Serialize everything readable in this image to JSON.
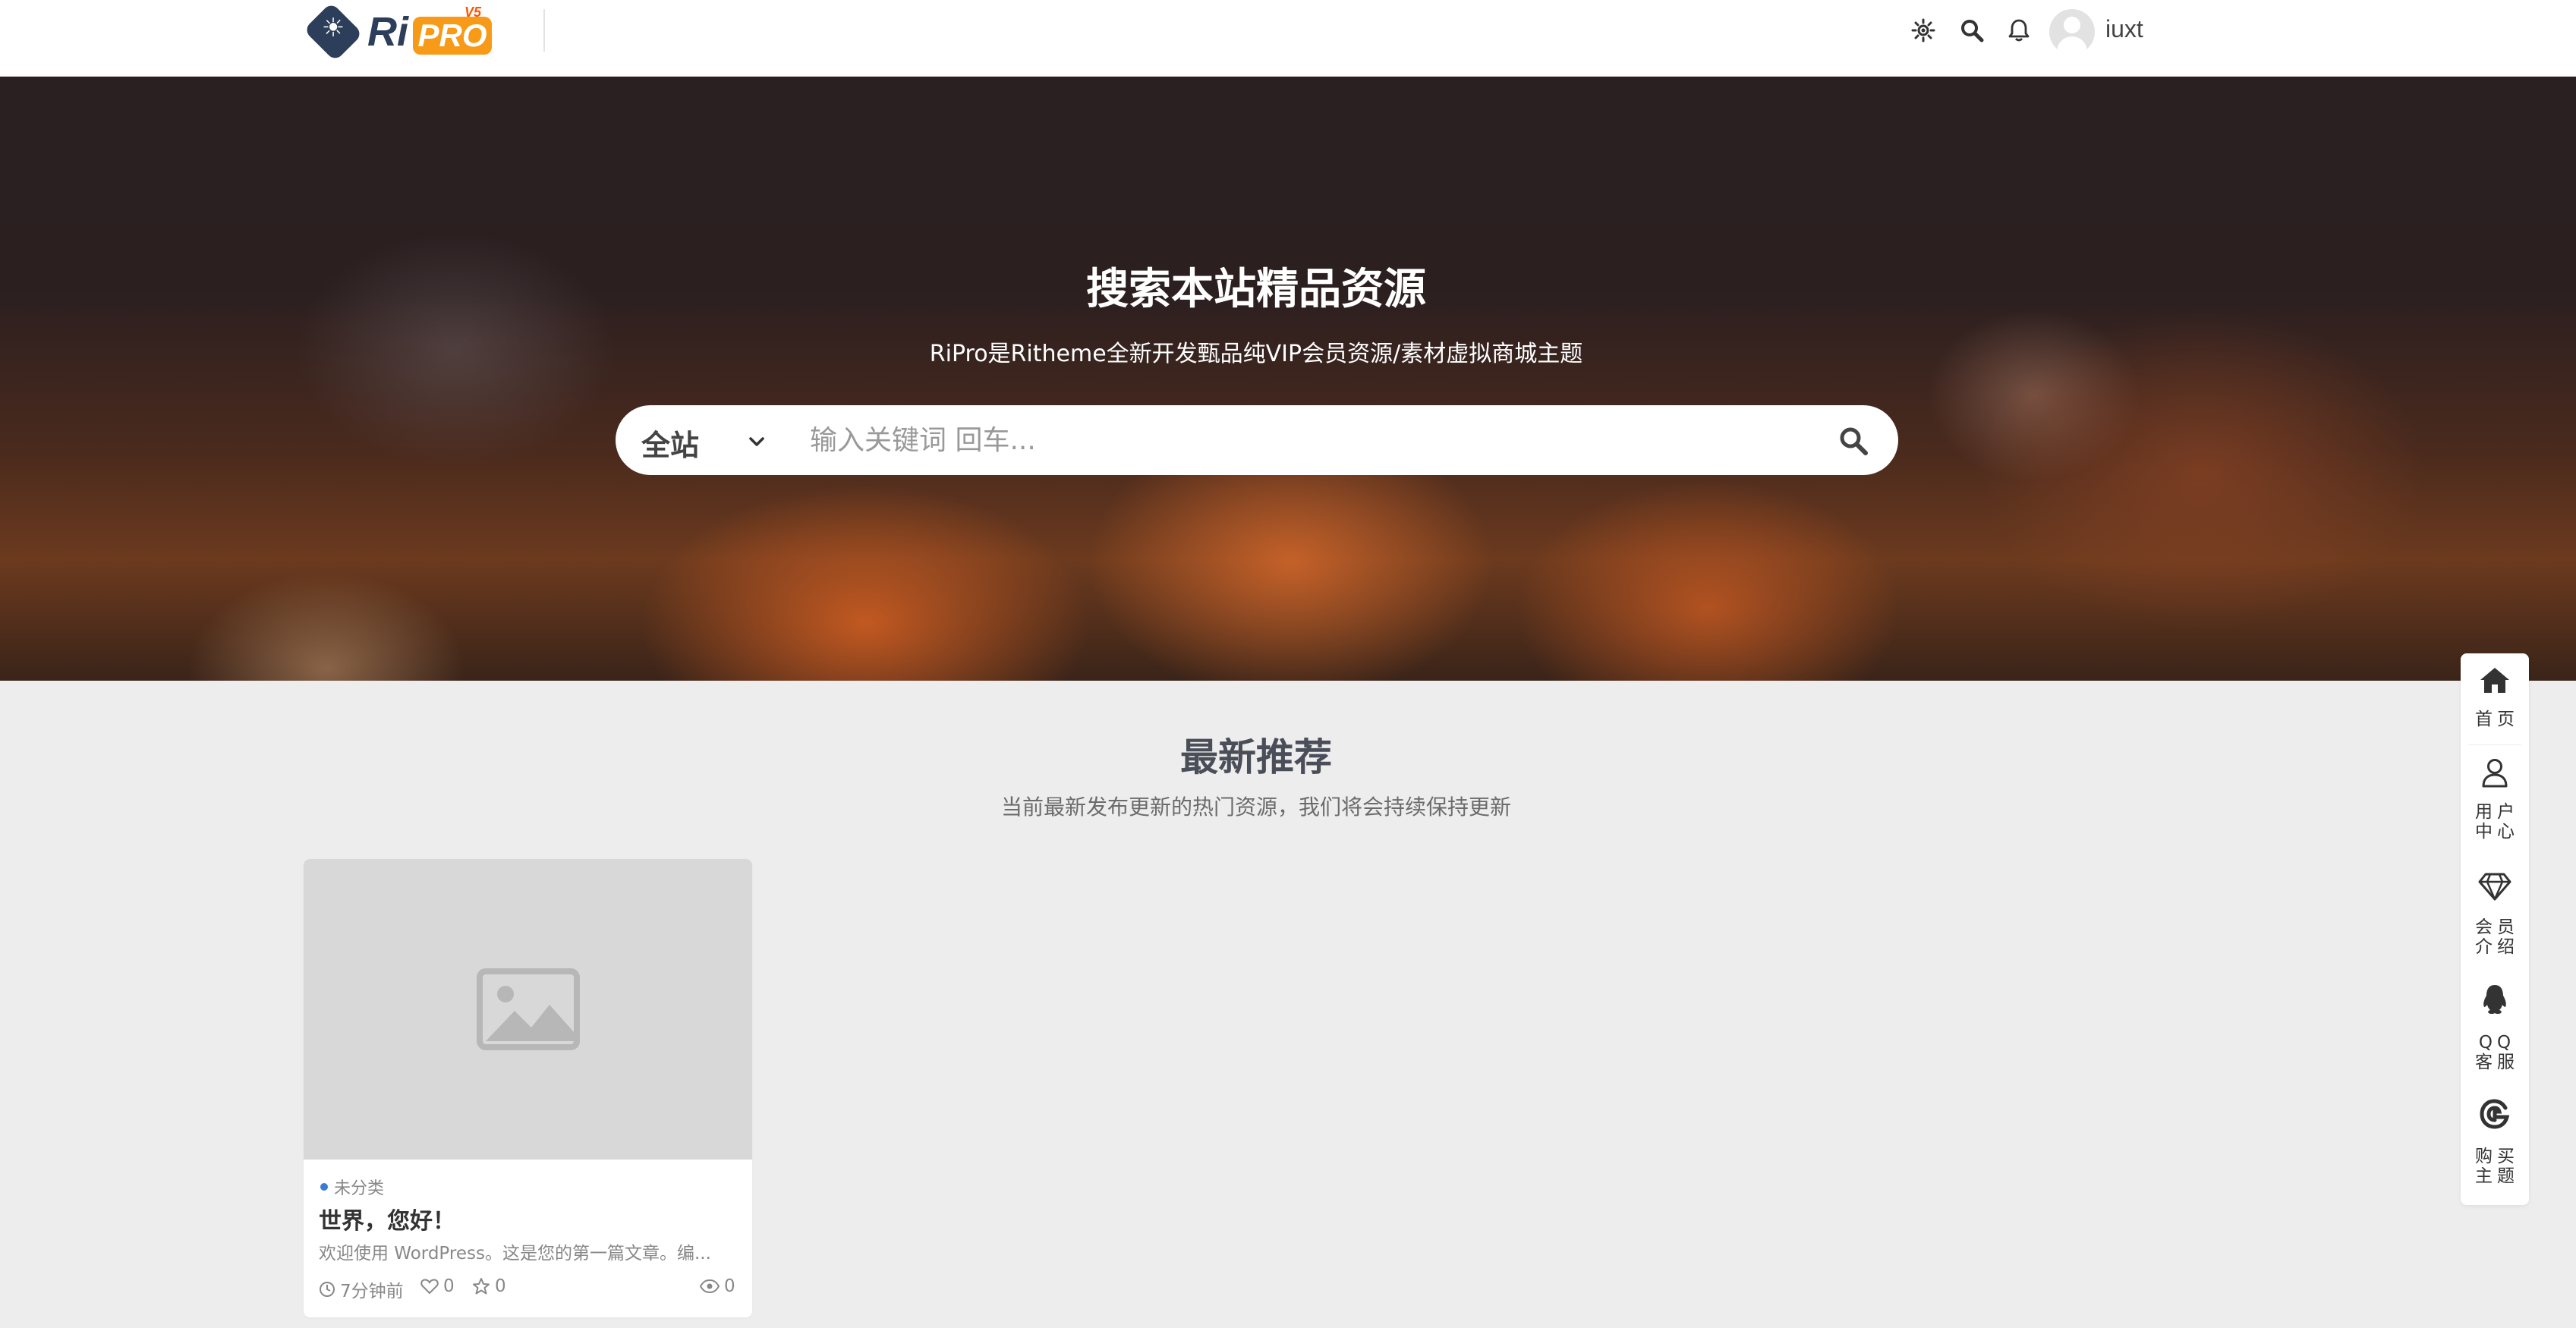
{
  "header": {
    "logo": {
      "ri": "Ri",
      "pro": "PRO",
      "version": "V5"
    },
    "username": "iuxt",
    "icons": [
      "theme-toggle-icon",
      "search-icon",
      "bell-icon",
      "avatar"
    ]
  },
  "hero": {
    "title": "搜索本站精品资源",
    "subtitle": "RiPro是Ritheme全新开发甄品纯VIP会员资源/素材虚拟商城主题",
    "search": {
      "category": "全站",
      "placeholder": "输入关键词 回车..."
    }
  },
  "section": {
    "title": "最新推荐",
    "subtitle": "当前最新发布更新的热门资源，我们将会持续保持更新"
  },
  "posts": [
    {
      "category": "未分类",
      "title": "世界，您好！",
      "excerpt": "欢迎使用 WordPress。这是您的第一篇文章。编...",
      "time": "7分钟前",
      "likes": "0",
      "favorites": "0",
      "views": "0"
    }
  ],
  "float_bar": {
    "items": [
      {
        "icon": "home-icon",
        "label": "首页"
      },
      {
        "icon": "user-icon",
        "label": "用户中心"
      },
      {
        "icon": "diamond-icon",
        "label": "会员介绍"
      },
      {
        "icon": "qq-icon",
        "label": "QQ客服"
      },
      {
        "icon": "buy-theme-icon",
        "label": "购买主题"
      }
    ],
    "labels_wrapped": [
      [
        "首页"
      ],
      [
        "用户",
        "中心"
      ],
      [
        "会员",
        "介绍"
      ],
      [
        "QQ",
        "客服"
      ],
      [
        "购买",
        "主题"
      ]
    ]
  },
  "colors": {
    "brand_navy": "#2c3e59",
    "brand_orange": "#f79a17",
    "category_dot": "#3a7bd5",
    "page_bg": "#ededed"
  }
}
